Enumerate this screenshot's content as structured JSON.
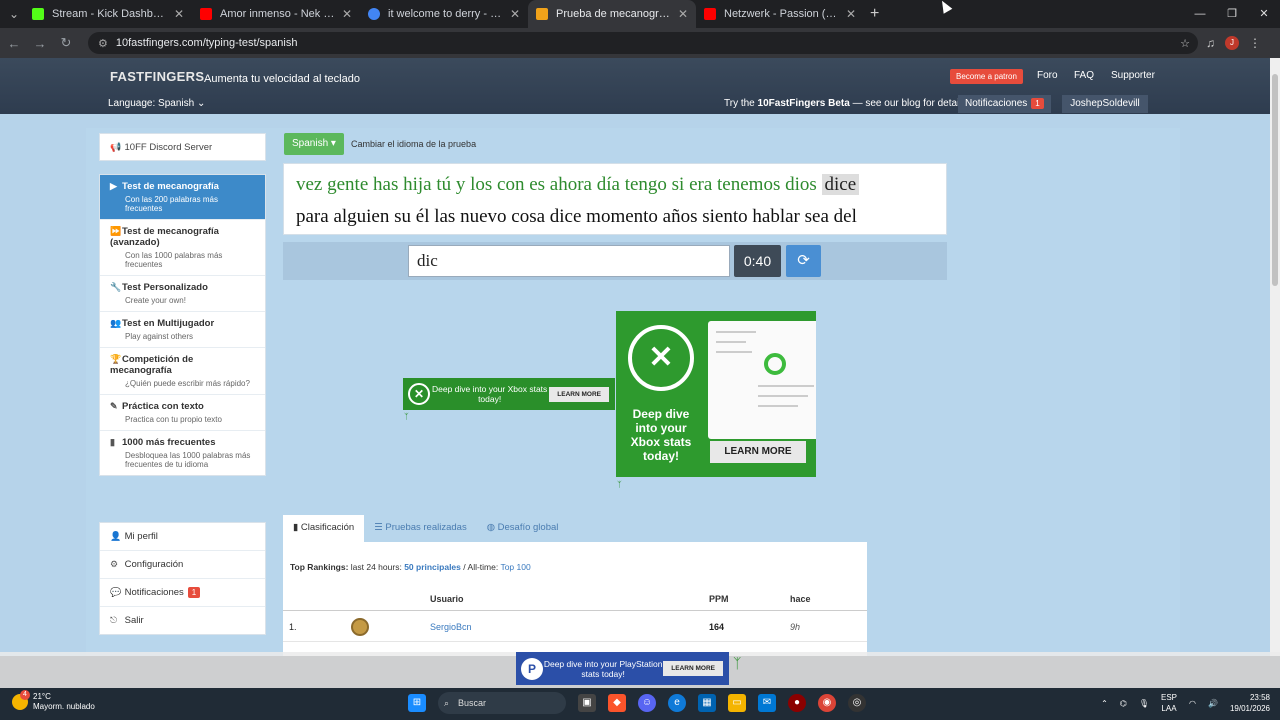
{
  "browser": {
    "tabs": [
      {
        "title": "Stream - Kick Dashboard",
        "color": "#53fc18",
        "active": false
      },
      {
        "title": "Amor inmenso - Nek (letra)",
        "color": "#ff0000",
        "active": false
      },
      {
        "title": "it welcome to derry - Buscar co",
        "color": "#4285f4",
        "active": false
      },
      {
        "title": "Prueba de mecanografía Spani",
        "color": "#f0a21a",
        "active": true
      },
      {
        "title": "Netzwerk - Passion (Extended",
        "color": "#ff0000",
        "active": false
      }
    ],
    "url": "10fastfingers.com/typing-test/spanish",
    "profile_initial": "J"
  },
  "header": {
    "logo": "FASTFINGERS",
    "tagline": "Aumenta tu velocidad al teclado",
    "patron_label": "Become a patron",
    "links": [
      "Foro",
      "FAQ",
      "Supporter"
    ],
    "language_label": "Language: Spanish",
    "beta_prefix": "Try the",
    "beta_bold": "10FastFingers Beta",
    "beta_suffix": "— see our blog for details",
    "notifications_label": "Notificaciones",
    "notifications_count": "1",
    "username": "JoshepSoldevill"
  },
  "sidebar": {
    "discord": "10FF Discord Server",
    "items": [
      {
        "title": "Test de mecanografía",
        "sub": "Con las 200 palabras más frecuentes",
        "icon": "play-icon",
        "active": true
      },
      {
        "title": "Test de mecanografía (avanzado)",
        "sub": "Con las 1000 palabras más frecuentes",
        "icon": "fast-forward-icon",
        "active": false
      },
      {
        "title": "Test Personalizado",
        "sub": "Create your own!",
        "icon": "wrench-icon",
        "active": false
      },
      {
        "title": "Test en Multijugador",
        "sub": "Play against others",
        "icon": "users-icon",
        "active": false
      },
      {
        "title": "Competición de mecanografía",
        "sub": "¿Quién puede escribir más rápido?",
        "icon": "trophy-icon",
        "active": false
      },
      {
        "title": "Práctica con texto",
        "sub": "Practica con tu propio texto",
        "icon": "edit-icon",
        "active": false
      },
      {
        "title": "1000 más frecuentes",
        "sub": "Desbloquea las 1000 palabras más frecuentes de tu idioma",
        "icon": "bar-chart-icon",
        "active": false
      }
    ],
    "account": [
      {
        "label": "Mi perfil",
        "icon": "user-icon"
      },
      {
        "label": "Configuración",
        "icon": "gear-icon"
      },
      {
        "label": "Notificaciones",
        "icon": "comment-icon",
        "badge": "1"
      },
      {
        "label": "Salir",
        "icon": "logout-icon"
      }
    ]
  },
  "typing": {
    "language_button": "Spanish",
    "change_language": "Cambiar el idioma de la prueba",
    "typed_words": "vez gente has hija tú y los con es ahora día tengo si era tenemos dios",
    "current_word": "dice",
    "next_line": "para alguien su él las nuevo cosa dice momento años siento hablar sea del",
    "input_value": "dic",
    "timer": "0:40"
  },
  "ads": {
    "banner_text": "Deep dive into your Xbox stats today!",
    "banner_button": "LEARN MORE",
    "square_text": "Deep dive into your Xbox stats today!",
    "square_button": "LEARN MORE",
    "bottom_text": "Deep dive into your PlayStation stats today!",
    "bottom_button": "LEARN MORE"
  },
  "rankings": {
    "tabs": [
      "Clasificación",
      "Pruebas realizadas",
      "Desafío global"
    ],
    "top_label": "Top Rankings:",
    "period": "last 24 hours:",
    "principal_link": "50 principales",
    "alltime": "/ All-time:",
    "top100": "Top 100",
    "col_user": "Usuario",
    "col_ppm": "PPM",
    "col_ago": "hace",
    "rows": [
      {
        "rank": "1.",
        "user": "SergioBcn",
        "ppm": "164",
        "ago": "9h"
      }
    ]
  },
  "taskbar": {
    "temp": "21°C",
    "weather": "Mayorm. nublado",
    "weather_badge": "4",
    "search": "Buscar",
    "lang1": "ESP",
    "lang2": "LAA",
    "time": "23:58",
    "date": "19/01/2026"
  }
}
